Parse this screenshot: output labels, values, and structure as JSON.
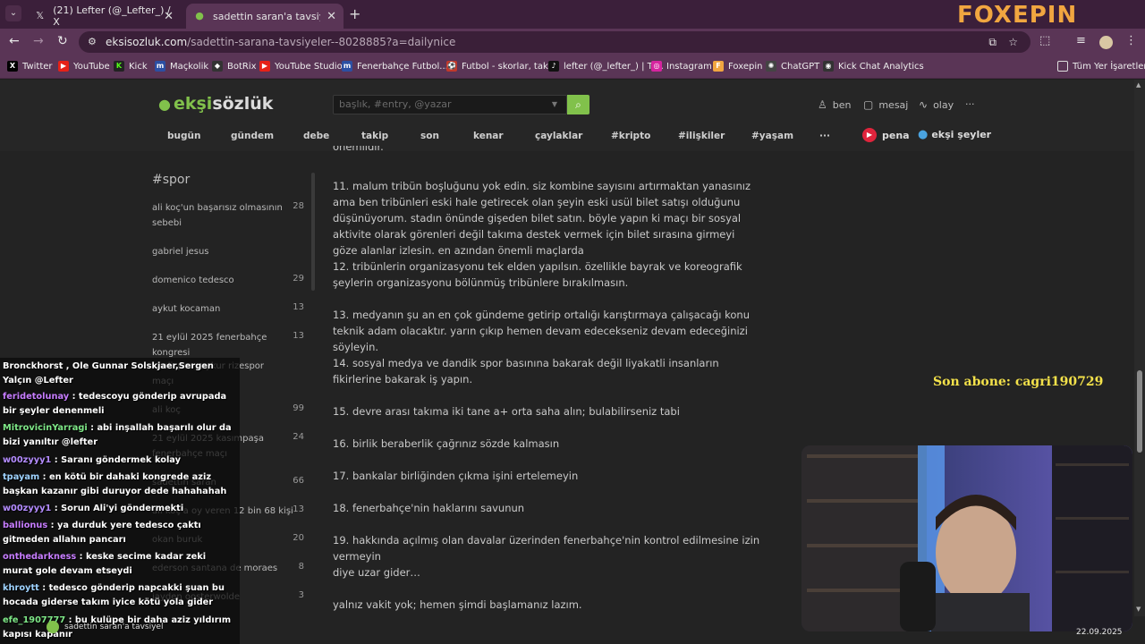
{
  "browser": {
    "tabs": [
      {
        "title": "(21) Lefter (@_Lefter_) / X",
        "icon": "x-icon"
      },
      {
        "title": "sadettin saran'a tavsiyeler - sor",
        "icon": "eksi-drop-icon"
      }
    ],
    "brand_overlay": "FOXEPIN",
    "url_host": "eksisozluk.com",
    "url_path": "/sadettin-sarana-tavsiyeler--8028885?a=dailynice",
    "bookmarks": [
      "Twitter",
      "YouTube",
      "Kick",
      "Maçkolik",
      "BotRix",
      "YouTube Studio",
      "Fenerbahçe Futbol...",
      "Futbol - skorlar, tak...",
      "lefter (@_lefter_) | Ti...",
      "Instagram",
      "Foxepin",
      "ChatGPT",
      "Kick Chat Analytics",
      "Tüm Yer İşaretleri"
    ]
  },
  "site": {
    "logo_a": "ekşi",
    "logo_b": "sözlük",
    "search_placeholder": "başlık, #entry, @yazar",
    "user_menu": [
      "ben",
      "mesaj",
      "olay",
      "···"
    ],
    "nav": [
      "bugün",
      "gündem",
      "debe",
      "takip",
      "son",
      "kenar",
      "çaylaklar",
      "#kripto",
      "#ilişkiler",
      "#yaşam",
      "···"
    ],
    "pena": "pena",
    "eksi_seyler": "ekşi şeyler"
  },
  "sidebar": {
    "title": "#spor",
    "items": [
      {
        "label": "ali koç'un başarısız olmasının sebebi",
        "count": "28"
      },
      {
        "label": "gabriel jesus",
        "count": ""
      },
      {
        "label": "domenico tedesco",
        "count": "29"
      },
      {
        "label": "aykut kocaman",
        "count": "13"
      },
      {
        "label": "21 eylül 2025 fenerbahçe kongresi",
        "count": "13"
      },
      {
        "label": "caelispor çaykur rizespor maçı",
        "count": ""
      },
      {
        "label": "ali koç",
        "count": "99"
      },
      {
        "label": "21 eylül 2025 kasımpaşa fenerbahçe maçı",
        "count": "24"
      },
      {
        "label": "sadettin saran",
        "count": "66"
      },
      {
        "label": "ali koç'a oy veren 12 bin 68 kişi",
        "count": "13"
      },
      {
        "label": "okan buruk",
        "count": "20"
      },
      {
        "label": "ederson santana de moraes",
        "count": "8"
      },
      {
        "label": "jayden oosterwolde",
        "count": "3"
      }
    ]
  },
  "entry": {
    "top_fragment": "önemlidir.",
    "paragraphs": [
      "11. malum tribün boşluğunu yok edin. siz kombine sayısını artırmaktan yanasınız ama ben tribünleri eski hale getirecek olan şeyin eski usül bilet satışı olduğunu düşünüyorum. stadın önünde gişeden bilet satın. böyle yapın ki maçı bir sosyal aktivite olarak görenleri değil takıma destek vermek için bilet sırasına girmeyi göze alanlar izlesin. en azından önemli maçlarda",
      "12. tribünlerin organizasyonu tek elden yapılsın. özellikle bayrak ve koreografik şeylerin organizasyonu bölünmüş tribünlere bırakılmasın.",
      "13. medyanın şu an en çok gündeme getirip ortalığı karıştırmaya çalışacağı konu teknik adam olacaktır. yarın çıkıp hemen devam edecekseniz devam edeceğinizi söyleyin.",
      "14. sosyal medya ve dandik spor basınına bakarak değil liyakatli insanların fikirlerine bakarak iş yapın.",
      "15. devre arası takıma iki tane a+ orta saha alın; bulabilirseniz tabi",
      "16. birlik beraberlik çağrınız sözde kalmasın",
      "17. bankalar birliğinden çıkma işini ertelemeyin",
      "18. fenerbahçe'nin haklarını savunun",
      "19. hakkında açılmış olan davalar üzerinden fenerbahçe'nin kontrol edilmesine izin vermeyin",
      "diye uzar gider…",
      "yalnız vakit yok; hemen şimdi başlamanız lazım."
    ]
  },
  "overlay": {
    "subscriber": "Son abone: cagri190729",
    "chat": [
      {
        "user": "",
        "color": "#ffffff",
        "text": "Bronckhorst , Ole Gunnar Solskjaer,Sergen Yalçın @Lefter"
      },
      {
        "user": "feridetolunay",
        "color": "#c77dff",
        "text": "tedescoyu gönderip avrupada bir şeyler denenmeli"
      },
      {
        "user": "MitrovicinYarragi",
        "color": "#7ee787",
        "text": "abi inşallah başarılı olur da bizi yanıltır @lefter"
      },
      {
        "user": "w00zyyy1",
        "color": "#b48cff",
        "text": "Saranı göndermek kolay"
      },
      {
        "user": "tpayam",
        "color": "#9fd3ff",
        "text": "en kötü bir dahaki kongrede aziz başkan kazanır gibi duruyor dede hahahahah"
      },
      {
        "user": "w00zyyy1",
        "color": "#b48cff",
        "text": "Sorun Ali'yi göndermekti"
      },
      {
        "user": "ballionus",
        "color": "#c77dff",
        "text": "ya durduk yere tedesco çaktı gitmeden allahın pancarı"
      },
      {
        "user": "onthedarkness",
        "color": "#c77dff",
        "text": "keske secime kadar zeki murat gole devam etseydi"
      },
      {
        "user": "khroytt",
        "color": "#9fd3ff",
        "text": "tedesco gönderip napcakki şuan bu hocada giderse takım iyice kötü yola gider"
      },
      {
        "user": "efe_1907777",
        "color": "#7ee787",
        "text": "bu kulüpe bir daha aziz yıldırım kapısı kapanır"
      }
    ]
  },
  "taskbar": {
    "item": "sadettin saran'a tavsiyel",
    "date": "22.09.2025"
  }
}
